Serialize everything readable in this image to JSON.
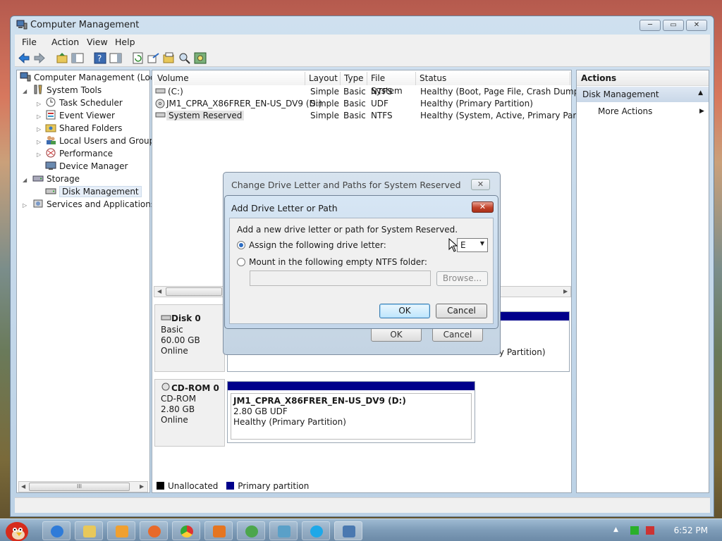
{
  "window": {
    "title": "Computer Management",
    "controls": {
      "minimize": "─",
      "maximize": "▭",
      "close": "✕"
    }
  },
  "menu": [
    "File",
    "Action",
    "View",
    "Help"
  ],
  "tree": {
    "root": "Computer Management (Local",
    "system_tools": "System Tools",
    "items": [
      "Task Scheduler",
      "Event Viewer",
      "Shared Folders",
      "Local Users and Groups",
      "Performance",
      "Device Manager"
    ],
    "storage": "Storage",
    "disk_management": "Disk Management",
    "services": "Services and Applications"
  },
  "volume_table": {
    "headers": [
      "Volume",
      "Layout",
      "Type",
      "File System",
      "Status"
    ],
    "rows": [
      [
        "(C:)",
        "Simple",
        "Basic",
        "NTFS",
        "Healthy (Boot, Page File, Crash Dump, Pr"
      ],
      [
        "JM1_CPRA_X86FRER_EN-US_DV9 (D:)",
        "Simple",
        "Basic",
        "UDF",
        "Healthy (Primary Partition)"
      ],
      [
        "System Reserved",
        "Simple",
        "Basic",
        "NTFS",
        "Healthy (System, Active, Primary Partitio"
      ]
    ]
  },
  "disks": {
    "disk0": {
      "name": "Disk 0",
      "kind": "Basic",
      "size": "60.00 GB",
      "state": "Online",
      "partition_peek": "ry Partition)"
    },
    "cdrom0": {
      "name": "CD-ROM 0",
      "kind": "CD-ROM",
      "size": "2.80 GB",
      "state": "Online",
      "volume": "JM1_CPRA_X86FRER_EN-US_DV9  (D:)",
      "volume_size": "2.80 GB UDF",
      "volume_status": "Healthy (Primary Partition)"
    }
  },
  "legend": {
    "unallocated": "Unallocated",
    "primary": "Primary partition",
    "unallocated_color": "#000000",
    "primary_color": "#00008b"
  },
  "actions": {
    "header": "Actions",
    "section": "Disk Management",
    "more": "More Actions"
  },
  "hscroll": {
    "grip": "III"
  },
  "dialog_back": {
    "title": "Change Drive Letter and Paths for System Reserved",
    "ok": "OK",
    "cancel": "Cancel"
  },
  "dialog_front": {
    "title": "Add Drive Letter or Path",
    "prompt": "Add a new drive letter or path for System Reserved.",
    "assign_label": "Assign the following drive letter:",
    "drive_letter": "E",
    "mount_label": "Mount in the following empty NTFS folder:",
    "folder_value": "",
    "browse": "Browse...",
    "ok": "OK",
    "cancel": "Cancel",
    "close": "✕"
  },
  "taskbar": {
    "clock": "6:52 PM"
  },
  "icons": [
    "back-icon",
    "forward-icon",
    "up-icon",
    "show-hide-icon",
    "help-icon",
    "refresh-icon",
    "export-icon",
    "properties-icon",
    "search-icon",
    "settings-icon"
  ]
}
